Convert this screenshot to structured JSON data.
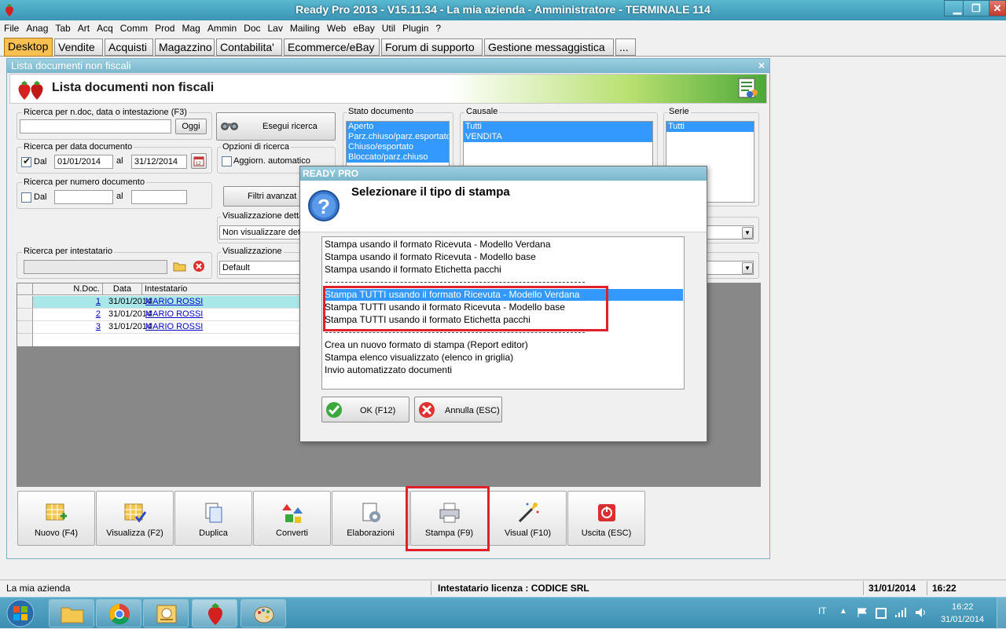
{
  "window": {
    "title": "Ready Pro 2013 - V15.11.34 - La mia azienda - Amministratore - TERMINALE 114",
    "min_label": "▁",
    "max_label": "❐",
    "close_label": "✕"
  },
  "menu": [
    "File",
    "Anag",
    "Tab",
    "Art",
    "Acq",
    "Comm",
    "Prod",
    "Mag",
    "Ammin",
    "Doc",
    "Lav",
    "Mailing",
    "Web",
    "eBay",
    "Util",
    "Plugin",
    "?"
  ],
  "tabs": [
    "Desktop",
    "Vendite",
    "Acquisti",
    "Magazzino",
    "Contabilita'",
    "Ecommerce/eBay",
    "Forum di supporto",
    "Gestione messaggistica",
    "..."
  ],
  "active_tab": "Desktop",
  "inner_window": {
    "title": "Lista documenti non fiscali",
    "close_label": "×",
    "header": "Lista documenti non fiscali"
  },
  "search": {
    "group_label": "Ricerca per n.doc, data o intestazione (F3)",
    "value": "",
    "today_button": "Oggi",
    "execute_button": "Esegui ricerca"
  },
  "date_search": {
    "group_label": "Ricerca per data documento",
    "dal_label": "Dal",
    "al_label": "al",
    "from": "01/01/2014",
    "to": "31/12/2014",
    "dal_checked": true
  },
  "number_search": {
    "group_label": "Ricerca per numero documento",
    "dal_label": "Dal",
    "al_label": "al",
    "from": "",
    "to": ""
  },
  "options": {
    "group_label": "Opzioni di ricerca",
    "auto_update": "Aggiorn. automatico",
    "filters_button": "Filtri avanzat"
  },
  "detail_view": {
    "group_label": "Visualizzazione detta",
    "value": "Non visualizzare det"
  },
  "holder_search": {
    "group_label": "Ricerca per intestatario",
    "value": ""
  },
  "view": {
    "group_label": "Visualizzazione",
    "value": "Default"
  },
  "stato": {
    "group_label": "Stato documento",
    "items": [
      "Aperto",
      "Parz.chiuso/parz.esportato",
      "Chiuso/esportato",
      "Bloccato/parz.chiuso"
    ]
  },
  "causale": {
    "group_label": "Causale",
    "items": [
      "Tutti",
      "VENDITA"
    ]
  },
  "serie": {
    "group_label": "Serie",
    "items": [
      "Tutti"
    ]
  },
  "table": {
    "columns": [
      "N.Doc.",
      "Data",
      "Intestatario"
    ],
    "rows": [
      {
        "n": "1",
        "date": "31/01/2014",
        "holder": "MARIO ROSSI"
      },
      {
        "n": "2",
        "date": "31/01/2014",
        "holder": "MARIO ROSSI"
      },
      {
        "n": "3",
        "date": "31/01/2014",
        "holder": "MARIO ROSSI"
      }
    ]
  },
  "toolbar": [
    {
      "label": "Nuovo (F4)",
      "icon": "new-grid-icon"
    },
    {
      "label": "Visualizza (F2)",
      "icon": "view-grid-icon"
    },
    {
      "label": "Duplica",
      "icon": "duplicate-icon"
    },
    {
      "label": "Converti",
      "icon": "convert-icon"
    },
    {
      "label": "Elaborazioni",
      "icon": "processing-icon"
    },
    {
      "label": "Stampa (F9)",
      "icon": "printer-icon"
    },
    {
      "label": "Visual (F10)",
      "icon": "magic-wand-icon"
    },
    {
      "label": "Uscita (ESC)",
      "icon": "exit-icon"
    }
  ],
  "dialog": {
    "title": "READY PRO",
    "question": "Selezionare il tipo di stampa",
    "options_group1": [
      "Stampa usando il formato Ricevuta - Modello Verdana",
      "Stampa usando il formato Ricevuta - Modello base",
      "Stampa usando il formato Etichetta pacchi"
    ],
    "options_group2": [
      "Stampa TUTTI usando il formato Ricevuta - Modello Verdana",
      "Stampa TUTTI usando il formato Ricevuta - Modello base",
      "Stampa TUTTI usando il formato Etichetta pacchi"
    ],
    "options_group3": [
      "Crea un nuovo formato di stampa (Report editor)",
      "Stampa elenco visualizzato (elenco in griglia)",
      "Invio automatizzato documenti"
    ],
    "selected_option": "Stampa TUTTI usando il formato Ricevuta - Modello Verdana",
    "ok_button": "OK (F12)",
    "cancel_button": "Annulla (ESC)"
  },
  "status": {
    "company": "La mia azienda",
    "license": "Intestatario licenza : CODICE SRL",
    "date": "31/01/2014",
    "time": "16:22"
  },
  "taskbar": {
    "lang": "IT",
    "time": "16:22",
    "date": "31/01/2014"
  },
  "colors": {
    "accent_tab": "#f8c050",
    "selection": "#3399ff",
    "highlight_box": "#e0202a",
    "row_selected": "#a8e8e8"
  }
}
